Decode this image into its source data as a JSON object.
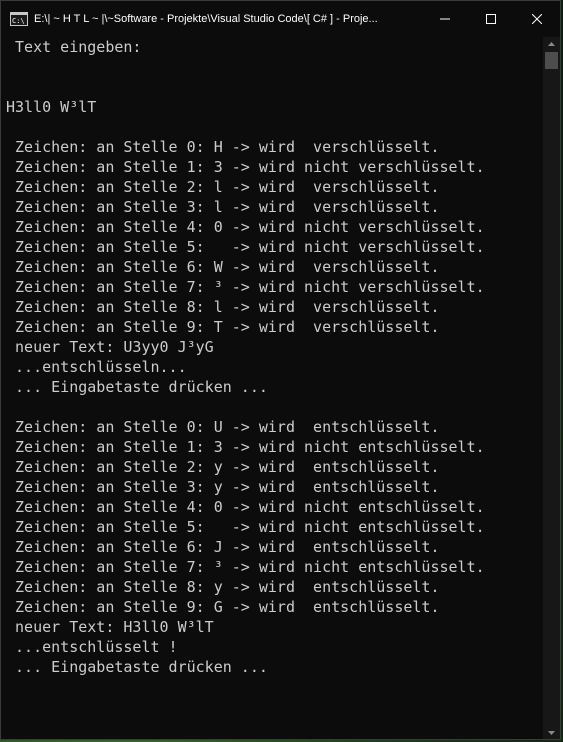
{
  "window": {
    "title": "E:\\| ~ H T L ~ |\\~Software - Projekte\\Visual Studio Code\\[ C# ] - Proje..."
  },
  "icons": {
    "app": "console-icon",
    "minimize": "minimize-icon",
    "maximize": "maximize-icon",
    "close": "close-icon"
  },
  "console": {
    "lines": [
      " Text eingeben:",
      "",
      "",
      "H3ll0 W³lT",
      "",
      " Zeichen: an Stelle 0: H -> wird  verschlüsselt.",
      " Zeichen: an Stelle 1: 3 -> wird nicht verschlüsselt.",
      " Zeichen: an Stelle 2: l -> wird  verschlüsselt.",
      " Zeichen: an Stelle 3: l -> wird  verschlüsselt.",
      " Zeichen: an Stelle 4: 0 -> wird nicht verschlüsselt.",
      " Zeichen: an Stelle 5:   -> wird nicht verschlüsselt.",
      " Zeichen: an Stelle 6: W -> wird  verschlüsselt.",
      " Zeichen: an Stelle 7: ³ -> wird nicht verschlüsselt.",
      " Zeichen: an Stelle 8: l -> wird  verschlüsselt.",
      " Zeichen: an Stelle 9: T -> wird  verschlüsselt.",
      " neuer Text: U3yy0 J³yG",
      " ...entschlüsseln...",
      " ... Eingabetaste drücken ...",
      "",
      " Zeichen: an Stelle 0: U -> wird  entschlüsselt.",
      " Zeichen: an Stelle 1: 3 -> wird nicht entschlüsselt.",
      " Zeichen: an Stelle 2: y -> wird  entschlüsselt.",
      " Zeichen: an Stelle 3: y -> wird  entschlüsselt.",
      " Zeichen: an Stelle 4: 0 -> wird nicht entschlüsselt.",
      " Zeichen: an Stelle 5:   -> wird nicht entschlüsselt.",
      " Zeichen: an Stelle 6: J -> wird  entschlüsselt.",
      " Zeichen: an Stelle 7: ³ -> wird nicht entschlüsselt.",
      " Zeichen: an Stelle 8: y -> wird  entschlüsselt.",
      " Zeichen: an Stelle 9: G -> wird  entschlüsselt.",
      " neuer Text: H3ll0 W³lT",
      " ...entschlüsselt !",
      " ... Eingabetaste drücken ..."
    ]
  },
  "colors": {
    "background": "#0c0c0c",
    "text": "#cccccc"
  }
}
